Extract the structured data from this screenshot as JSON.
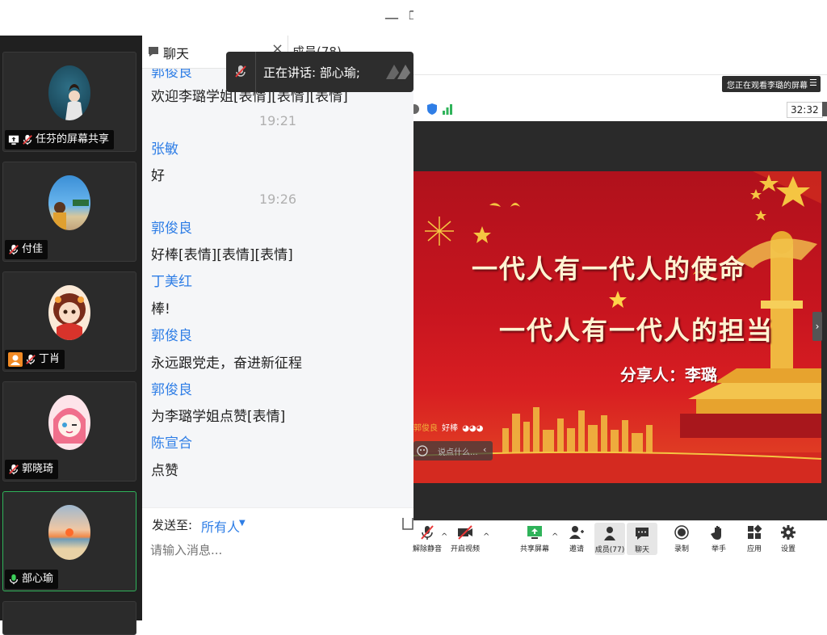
{
  "window": {
    "minimize": "—",
    "restore": "❐"
  },
  "participants": [
    {
      "name": "任芬的屏幕共享",
      "mic": "muted",
      "share": true,
      "av": "blue"
    },
    {
      "name": "付佳",
      "mic": "muted",
      "av": "beach"
    },
    {
      "name": "丁肖",
      "mic": "muted",
      "badge": "person",
      "av": "girl"
    },
    {
      "name": "郭晓琦",
      "mic": "muted",
      "av": "pink"
    },
    {
      "name": "部心瑜",
      "mic": "on",
      "active": true,
      "av": "sunset"
    }
  ],
  "chat": {
    "tab_chat": "聊天",
    "tab_members": "成员(78)",
    "close": "×",
    "messages": [
      {
        "name": "郭俊良",
        "text": "欢迎李璐学姐[表情][表情][表情]"
      },
      {
        "time": "19:21"
      },
      {
        "name": "张敏",
        "text": "好"
      },
      {
        "time": "19:26"
      },
      {
        "name": "郭俊良",
        "text": "好棒[表情][表情][表情]"
      },
      {
        "name": "丁美红",
        "text": "棒!"
      },
      {
        "name": "郭俊良",
        "text": "永远跟党走，奋进新征程"
      },
      {
        "name": "郭俊良",
        "text": "为李璐学姐点赞[表情]"
      },
      {
        "name": "陈宣合",
        "text": "点赞"
      }
    ],
    "send_to_label": "发送至:",
    "send_to_value": "所有人",
    "input_placeholder": "请输入消息..."
  },
  "speaking": {
    "text": "正在讲话: 部心瑜;"
  },
  "viewing": {
    "text": "您正在观看李璐的屏幕"
  },
  "timer": "32:32",
  "slide": {
    "title1": "一代人有一代人的使命",
    "title2": "一代人有一代人的担当",
    "presenter": "分享人：李璐",
    "danmu_name": "郭俊良",
    "danmu_text": "好棒",
    "danmu_input": "说点什么..."
  },
  "toolbar": {
    "unmute": "解除静音",
    "video": "开启视频",
    "share": "共享屏幕",
    "invite": "邀请",
    "members": "成员(77)",
    "chat": "聊天",
    "record": "录制",
    "raise_hand": "举手",
    "apps": "应用",
    "settings": "设置"
  },
  "colors": {
    "accent": "#2f7ee6",
    "active_border": "#2fb35a",
    "slide_red": "#c8151f",
    "gold": "#f5c542"
  }
}
